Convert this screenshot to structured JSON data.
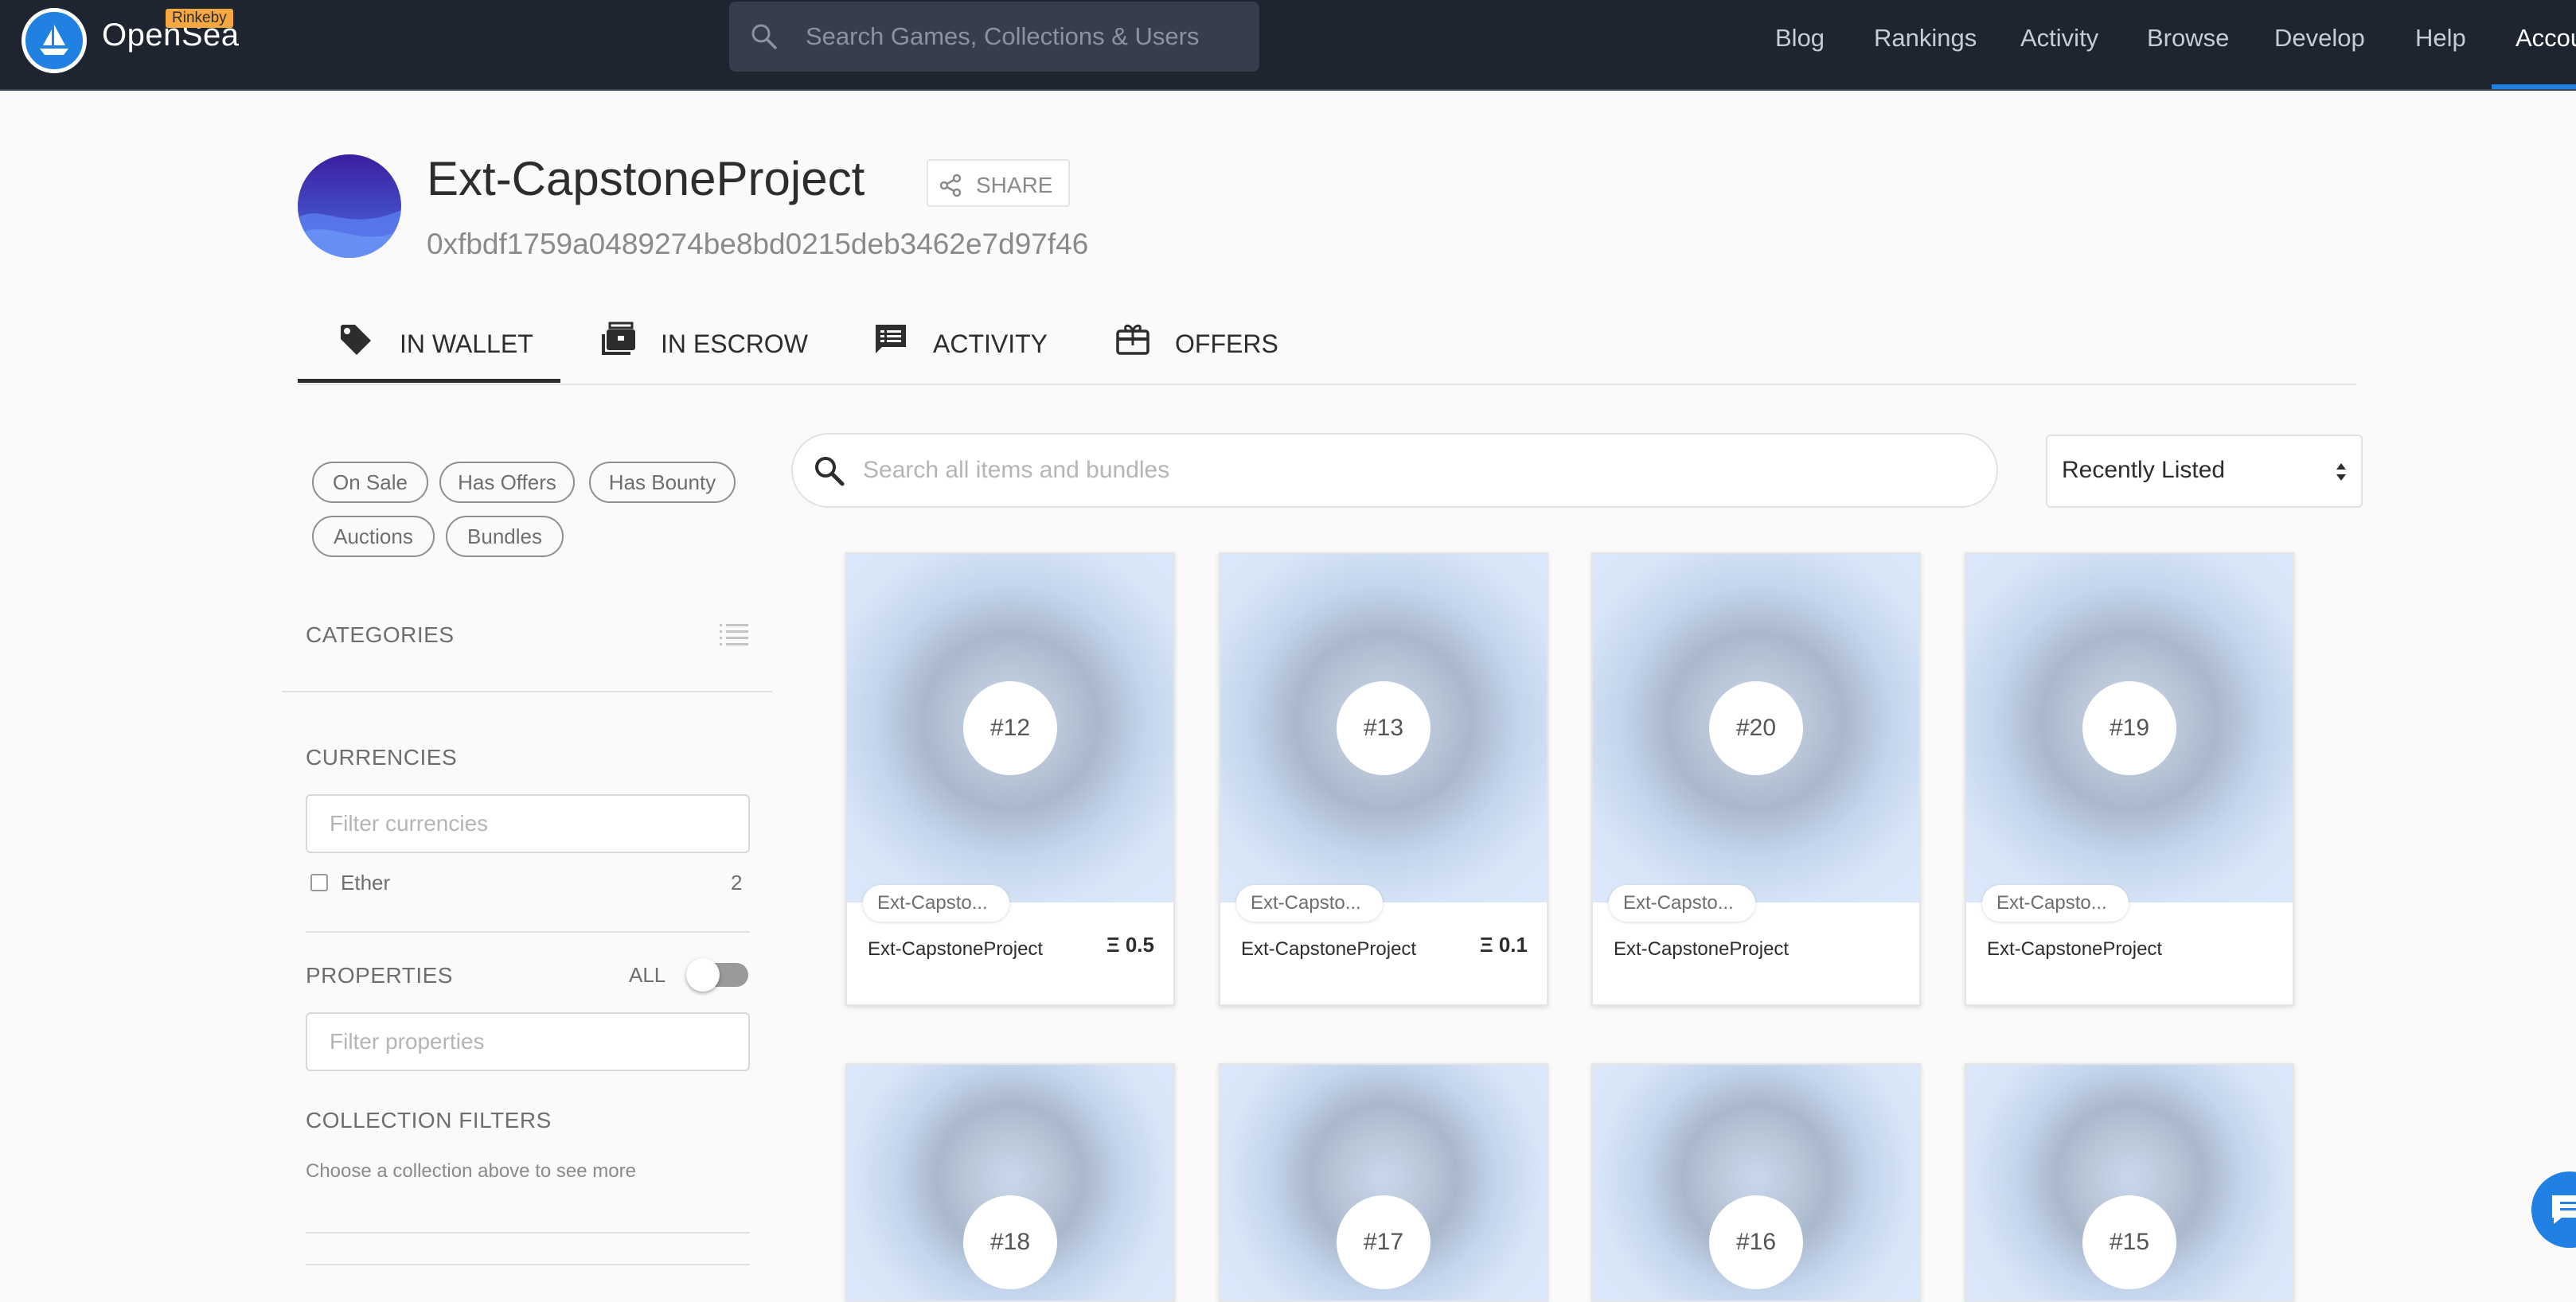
{
  "nav": {
    "brand": "OpenSea",
    "network_badge": "Rinkeby",
    "search_placeholder": "Search Games, Collections & Users",
    "links": [
      {
        "label": "Blog"
      },
      {
        "label": "Rankings"
      },
      {
        "label": "Activity"
      },
      {
        "label": "Browse"
      },
      {
        "label": "Develop"
      },
      {
        "label": "Help"
      },
      {
        "label": "Accou"
      }
    ]
  },
  "profile": {
    "name": "Ext-CapstoneProject",
    "share_label": "SHARE",
    "address": "0xfbdf1759a0489274be8bd0215deb3462e7d97f46"
  },
  "tabs": [
    {
      "label": "IN WALLET",
      "icon": "tag-icon",
      "active": true
    },
    {
      "label": "IN ESCROW",
      "icon": "briefcase-icon",
      "active": false
    },
    {
      "label": "ACTIVITY",
      "icon": "message-list-icon",
      "active": false
    },
    {
      "label": "OFFERS",
      "icon": "gift-card-icon",
      "active": false
    }
  ],
  "filters": {
    "pills": [
      "On Sale",
      "Has Offers",
      "Has Bounty",
      "Auctions",
      "Bundles"
    ],
    "categories_heading": "CATEGORIES",
    "currencies_heading": "CURRENCIES",
    "currency_filter_placeholder": "Filter currencies",
    "currencies": [
      {
        "name": "Ether",
        "count": "2"
      }
    ],
    "properties_heading": "PROPERTIES",
    "properties_all_label": "ALL",
    "properties_filter_placeholder": "Filter properties",
    "collection_filters_heading": "COLLECTION FILTERS",
    "collection_filters_hint": "Choose a collection above to see more"
  },
  "items": {
    "search_placeholder": "Search all items and bundles",
    "sort_value": "Recently Listed",
    "cards": [
      {
        "token": "#12",
        "collection": "Ext-Capsto...",
        "name": "Ext-CapstoneProject",
        "price": "Ξ 0.5"
      },
      {
        "token": "#13",
        "collection": "Ext-Capsto...",
        "name": "Ext-CapstoneProject",
        "price": "Ξ 0.1"
      },
      {
        "token": "#20",
        "collection": "Ext-Capsto...",
        "name": "Ext-CapstoneProject",
        "price": ""
      },
      {
        "token": "#19",
        "collection": "Ext-Capsto...",
        "name": "Ext-CapstoneProject",
        "price": ""
      },
      {
        "token": "#18"
      },
      {
        "token": "#17"
      },
      {
        "token": "#16"
      },
      {
        "token": "#15"
      }
    ]
  },
  "colors": {
    "navbar_bg": "#1e2430",
    "accent": "#2081e2",
    "network_badge": "#f5a742"
  }
}
